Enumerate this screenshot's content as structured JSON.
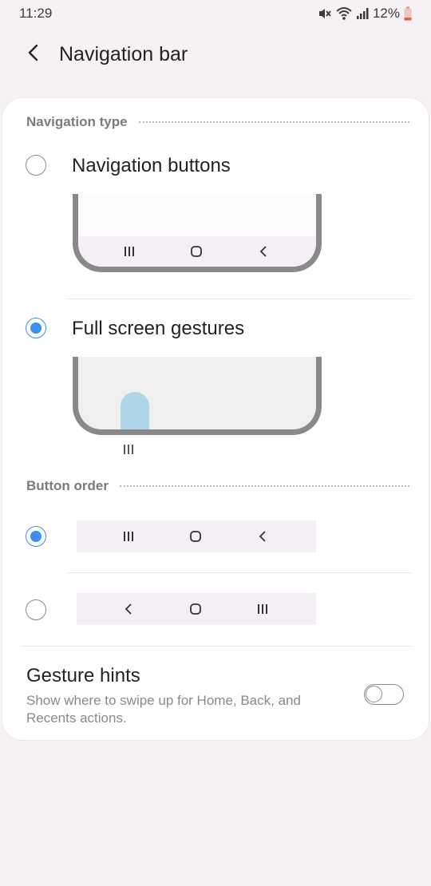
{
  "status_bar": {
    "time": "11:29",
    "battery_percent": "12%",
    "icons": [
      "mute-icon",
      "wifi-icon",
      "signal-icon",
      "battery-low-icon"
    ]
  },
  "app_bar": {
    "title": "Navigation bar",
    "back_icon": "chevron-left-icon"
  },
  "navigation_type": {
    "header": "Navigation type",
    "options": [
      {
        "label": "Navigation buttons",
        "selected": false
      },
      {
        "label": "Full screen gestures",
        "selected": true
      }
    ]
  },
  "button_order": {
    "header": "Button order",
    "options": [
      {
        "order": [
          "recents-icon",
          "home-icon",
          "back-icon"
        ],
        "selected": true
      },
      {
        "order": [
          "back-icon",
          "home-icon",
          "recents-icon"
        ],
        "selected": false
      }
    ]
  },
  "gesture_hints": {
    "title": "Gesture hints",
    "description": "Show where to swipe up for Home, Back, and Recents actions.",
    "enabled": false
  },
  "colors": {
    "accent": "#3e8df0",
    "background": "#f5f1f5",
    "card": "#ffffff",
    "gesture_pill": "#aed6e8"
  }
}
